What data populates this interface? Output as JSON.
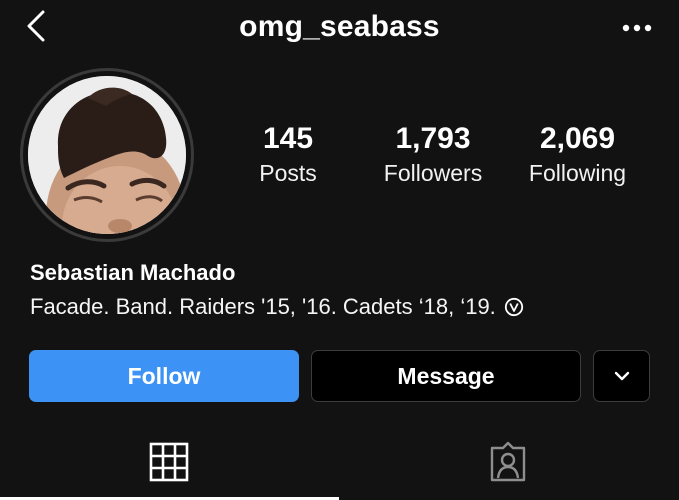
{
  "header": {
    "username": "omg_seabass",
    "back_icon": "chevron-left-icon",
    "more_icon": "more-horizontal-icon"
  },
  "profile": {
    "avatar_icon": "profile-photo",
    "stats": {
      "posts": {
        "value": "145",
        "label": "Posts"
      },
      "followers": {
        "value": "1,793",
        "label": "Followers"
      },
      "following": {
        "value": "2,069",
        "label": "Following"
      }
    },
    "name": "Sebastian Machado",
    "bio": "Facade. Band. Raiders '15, '16. Cadets ‘18, ‘19.",
    "bio_badge_icon": "circled-v-icon"
  },
  "actions": {
    "follow_label": "Follow",
    "message_label": "Message",
    "dropdown_icon": "chevron-down-icon"
  },
  "tabs": [
    {
      "name": "grid",
      "icon": "grid-icon",
      "active": true
    },
    {
      "name": "tagged",
      "icon": "tagged-person-icon",
      "active": false
    }
  ],
  "colors": {
    "background": "#121212",
    "follow_button": "#3d93f5",
    "button_border": "#3c3c3c"
  }
}
